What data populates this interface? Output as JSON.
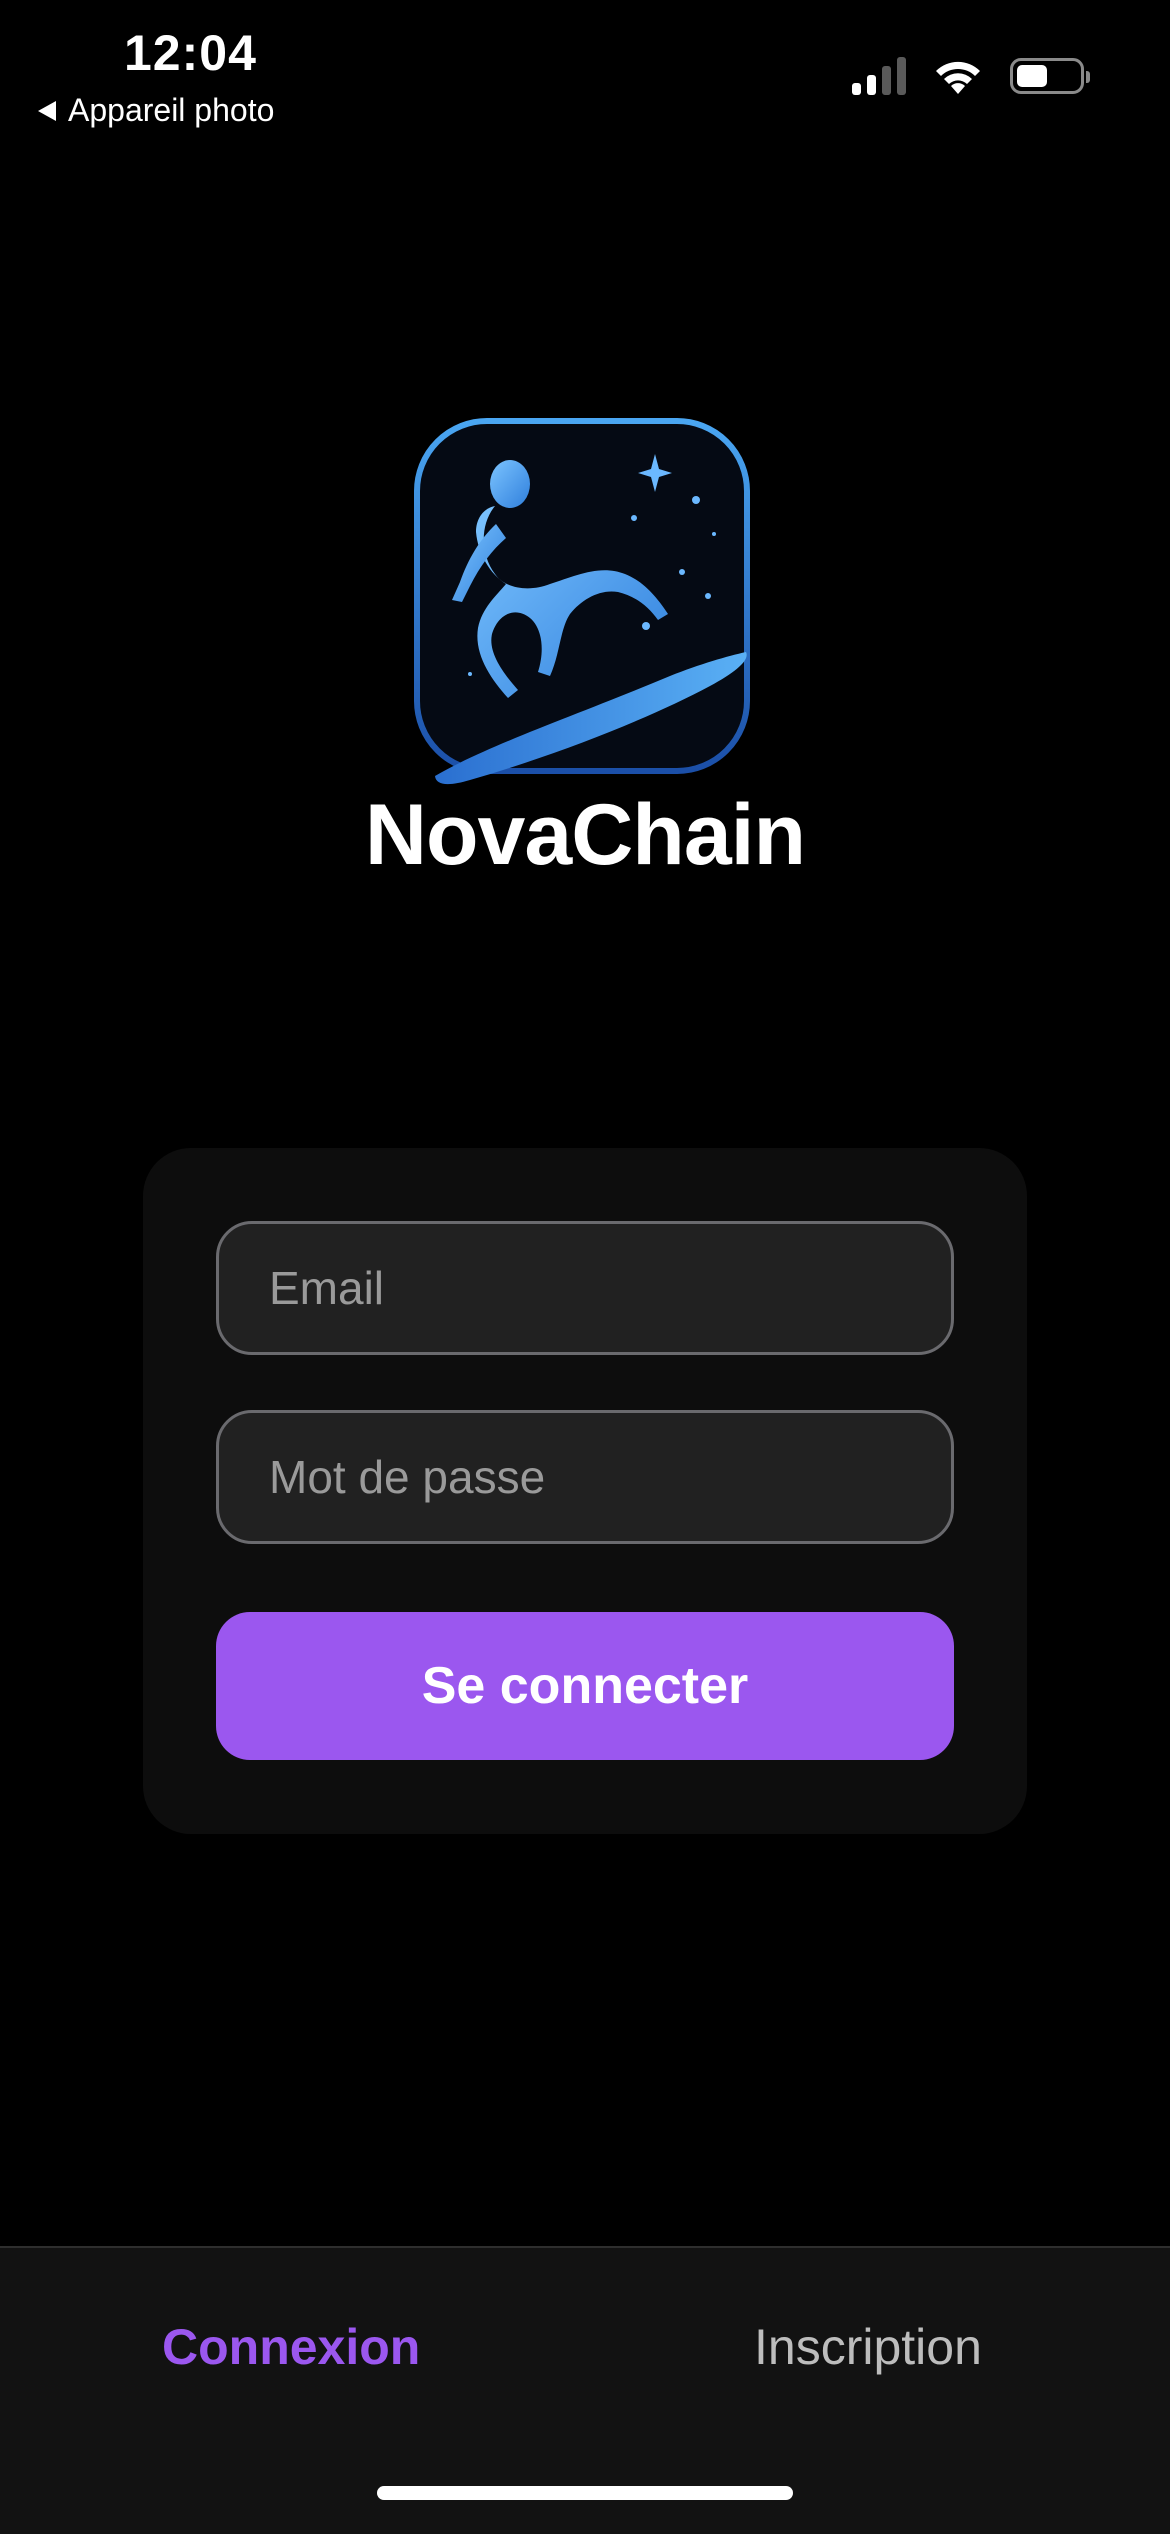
{
  "status_bar": {
    "time": "12:04",
    "back_label": "Appareil photo",
    "icons": [
      "cellular-signal-icon",
      "wifi-icon",
      "battery-icon"
    ]
  },
  "brand": {
    "name": "NovaChain",
    "logo_icon": "surfer-logo-icon",
    "accent_color": "#9b57ef",
    "logo_color": "#3a8ee6"
  },
  "login_form": {
    "email_placeholder": "Email",
    "password_placeholder": "Mot de passe",
    "submit_label": "Se connecter"
  },
  "tabs": [
    {
      "label": "Connexion",
      "active": true
    },
    {
      "label": "Inscription",
      "active": false
    }
  ]
}
